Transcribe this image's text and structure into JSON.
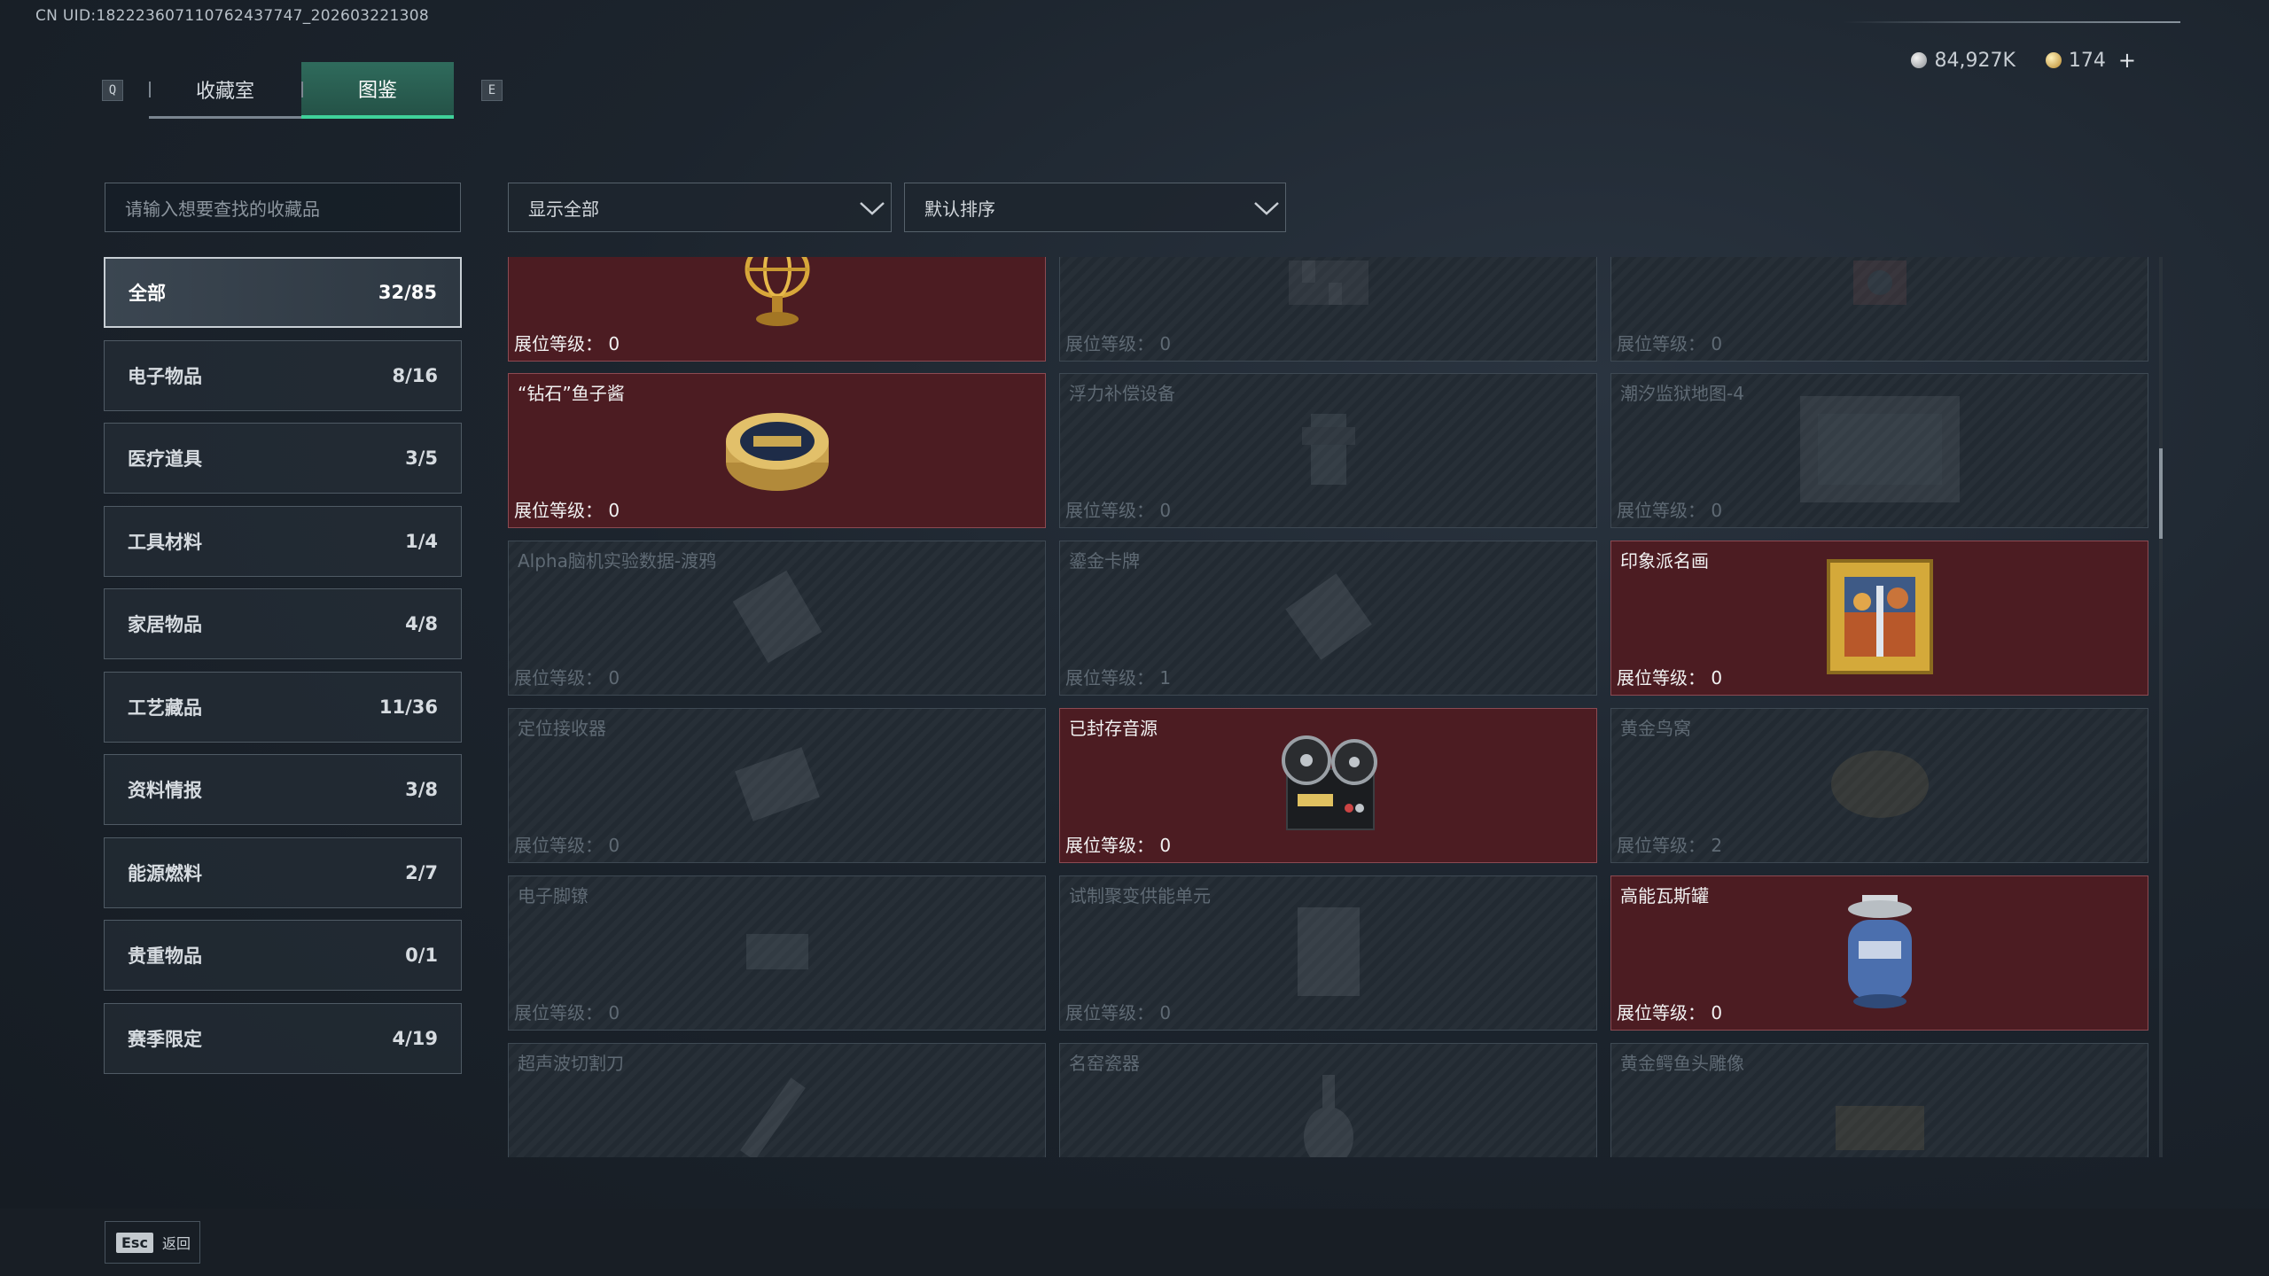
{
  "uid_text": "CN UID:182223607110762437747_202603221308",
  "tabs": {
    "left_key": "Q",
    "right_key": "E",
    "items": [
      "收藏室",
      "图鉴"
    ]
  },
  "currency": {
    "silver": "84,927K",
    "gold": "174",
    "plus": "+"
  },
  "search": {
    "placeholder": "请输入想要查找的收藏品"
  },
  "filters": {
    "show": "显示全部",
    "sort": "默认排序"
  },
  "categories": [
    {
      "label": "全部",
      "count": "32/85"
    },
    {
      "label": "电子物品",
      "count": "8/16"
    },
    {
      "label": "医疗道具",
      "count": "3/5"
    },
    {
      "label": "工具材料",
      "count": "1/4"
    },
    {
      "label": "家居物品",
      "count": "4/8"
    },
    {
      "label": "工艺藏品",
      "count": "11/36"
    },
    {
      "label": "资料情报",
      "count": "3/8"
    },
    {
      "label": "能源燃料",
      "count": "2/7"
    },
    {
      "label": "贵重物品",
      "count": "0/1"
    },
    {
      "label": "赛季限定",
      "count": "4/19"
    }
  ],
  "level_prefix": "展位等级：",
  "cards": [
    {
      "name": "",
      "level": "0",
      "owned": true,
      "icon": "armillary-sphere-icon"
    },
    {
      "name": "",
      "level": "0",
      "owned": false,
      "icon": "chessboard-icon"
    },
    {
      "name": "",
      "level": "0",
      "owned": false,
      "icon": "device-icon"
    },
    {
      "name": "“钻石”鱼子酱",
      "level": "0",
      "owned": true,
      "icon": "caviar-tin-icon"
    },
    {
      "name": "浮力补偿设备",
      "level": "0",
      "owned": false,
      "icon": "buoyancy-device-icon"
    },
    {
      "name": "潮汐监狱地图-4",
      "level": "0",
      "owned": false,
      "icon": "map-icon"
    },
    {
      "name": "Alpha脑机实验数据-渡鸦",
      "level": "0",
      "owned": false,
      "icon": "data-device-icon"
    },
    {
      "name": "鎏金卡牌",
      "level": "1",
      "owned": false,
      "icon": "card-icon"
    },
    {
      "name": "印象派名画",
      "level": "0",
      "owned": true,
      "icon": "painting-icon"
    },
    {
      "name": "定位接收器",
      "level": "0",
      "owned": false,
      "icon": "receiver-icon"
    },
    {
      "name": "已封存音源",
      "level": "0",
      "owned": true,
      "icon": "reel-recorder-icon"
    },
    {
      "name": "黄金鸟窝",
      "level": "2",
      "owned": false,
      "icon": "bird-nest-icon"
    },
    {
      "name": "电子脚镣",
      "level": "0",
      "owned": false,
      "icon": "ankle-monitor-icon"
    },
    {
      "name": "试制聚变供能单元",
      "level": "0",
      "owned": false,
      "icon": "fusion-unit-icon"
    },
    {
      "name": "高能瓦斯罐",
      "level": "0",
      "owned": true,
      "icon": "gas-canister-icon"
    },
    {
      "name": "超声波切割刀",
      "level": "",
      "owned": false,
      "icon": "cutter-icon"
    },
    {
      "name": "名窑瓷器",
      "level": "",
      "owned": false,
      "icon": "porcelain-icon"
    },
    {
      "name": "黄金鳄鱼头雕像",
      "level": "",
      "owned": false,
      "icon": "croc-statue-icon"
    }
  ],
  "footer": {
    "esc_key": "Esc",
    "back_label": "返回"
  },
  "colors": {
    "accent": "#3fd19a",
    "owned_card": "#4c1c22",
    "tab_active": "#2f6b5c"
  }
}
